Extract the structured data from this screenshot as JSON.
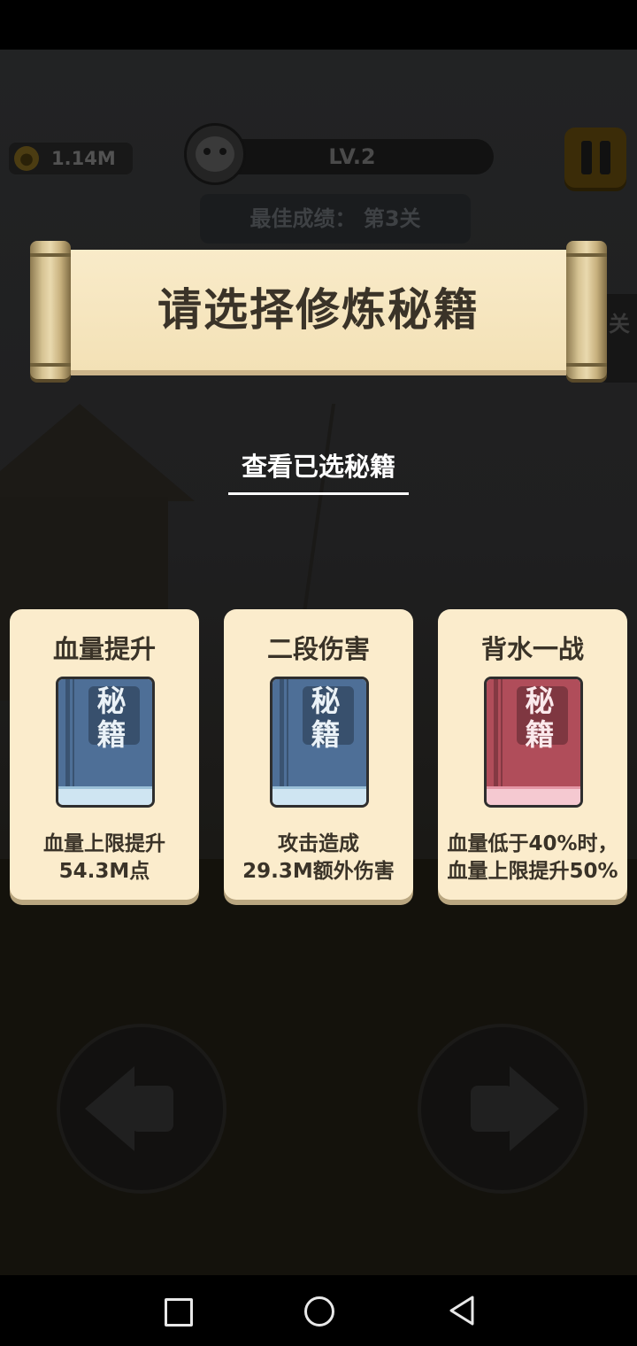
{
  "hud": {
    "coins": "1.14M",
    "level": "LV.2",
    "best_score": "最佳成绩： 第3关",
    "side_tab_label": "关"
  },
  "dialog": {
    "title": "请选择修炼秘籍",
    "view_selected_link": "查看已选秘籍"
  },
  "cards": [
    {
      "title": "血量提升",
      "book_char1": "秘",
      "book_char2": "籍",
      "book_color": "blue",
      "desc_line1": "血量上限提升",
      "desc_line2": "54.3M点"
    },
    {
      "title": "二段伤害",
      "book_char1": "秘",
      "book_char2": "籍",
      "book_color": "blue",
      "desc_line1": "攻击造成",
      "desc_line2": "29.3M额外伤害"
    },
    {
      "title": "背水一战",
      "book_char1": "秘",
      "book_char2": "籍",
      "book_color": "red",
      "desc_line1": "血量低于40%时，",
      "desc_line2": "血量上限提升50%"
    }
  ],
  "colors": {
    "paper": "#fbeccc",
    "book_blue": "#4e6f97",
    "book_red": "#b04d5a",
    "text_dark": "#3a3328"
  },
  "icons": {
    "coin": "coin-icon",
    "pause": "pause-icon",
    "move_left": "left-arrow-icon",
    "move_right": "right-arrow-icon",
    "nav_recent": "square-icon",
    "nav_home": "circle-icon",
    "nav_back": "triangle-back-icon"
  }
}
